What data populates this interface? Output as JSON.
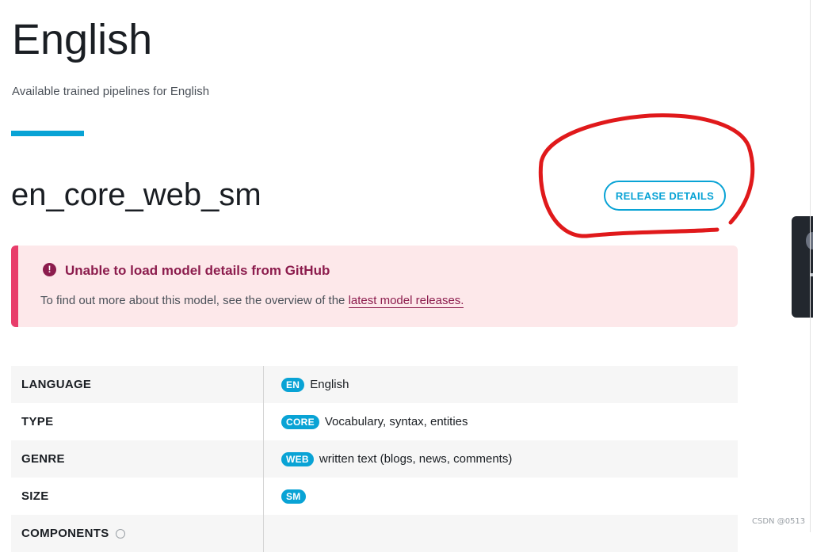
{
  "page": {
    "title": "English",
    "subtitle": "Available trained pipelines for English"
  },
  "model": {
    "name": "en_core_web_sm",
    "release_button": "RELEASE DETAILS"
  },
  "alert": {
    "icon": "!",
    "title": "Unable to load model details from GitHub",
    "text": "To find out more about this model, see the overview of the ",
    "link": "latest model releases."
  },
  "table": {
    "rows": [
      {
        "label": "LANGUAGE",
        "tag": "EN",
        "value": "English"
      },
      {
        "label": "TYPE",
        "tag": "CORE",
        "value": "Vocabulary, syntax, entities"
      },
      {
        "label": "GENRE",
        "tag": "WEB",
        "value": "written text (blogs, news, comments)"
      },
      {
        "label": "SIZE",
        "tag": "SM",
        "value": ""
      },
      {
        "label": "COMPONENTS",
        "tag": "",
        "value": ""
      }
    ]
  },
  "watermark": "CSDN @0513",
  "colors": {
    "accent": "#09a3d5",
    "alert_bg": "#fde8ea",
    "alert_border": "#e83d6b",
    "alert_text": "#8c1c4d",
    "annotation": "#e0191b"
  },
  "icons": {
    "alert": "exclamation-circle-icon",
    "components_help": "help-circle-icon"
  }
}
